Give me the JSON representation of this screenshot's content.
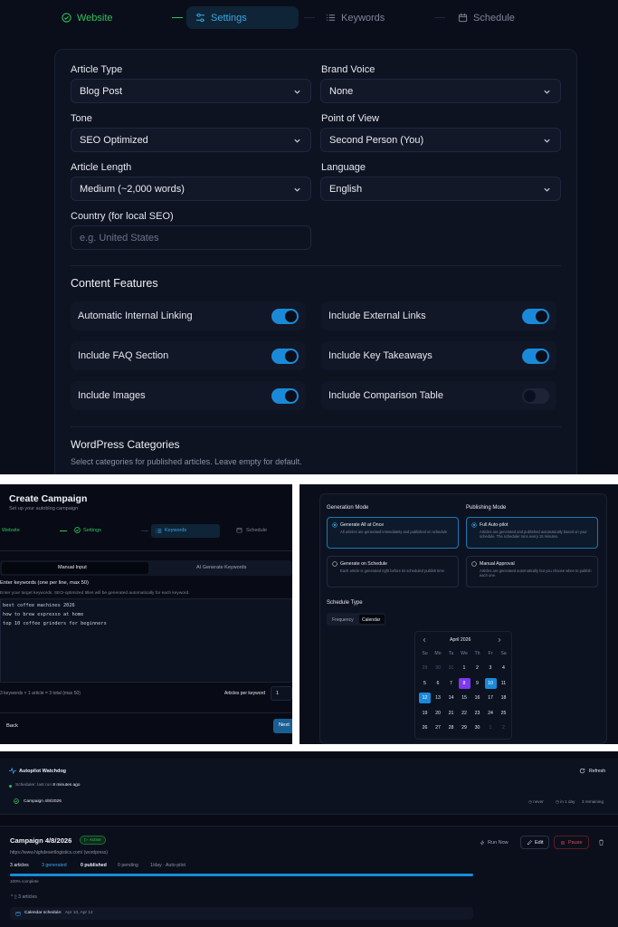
{
  "stepper": {
    "steps": [
      {
        "label": "Website",
        "state": "done"
      },
      {
        "label": "Settings",
        "state": "active"
      },
      {
        "label": "Keywords",
        "state": "pending"
      },
      {
        "label": "Schedule",
        "state": "pending"
      }
    ]
  },
  "settings": {
    "fields": [
      {
        "label": "Article Type",
        "value": "Blog Post"
      },
      {
        "label": "Brand Voice",
        "value": "None"
      },
      {
        "label": "Tone",
        "value": "SEO Optimized"
      },
      {
        "label": "Point of View",
        "value": "Second Person (You)"
      },
      {
        "label": "Article Length",
        "value": "Medium (~2,000 words)"
      },
      {
        "label": "Language",
        "value": "English"
      }
    ],
    "country": {
      "label": "Country (for local SEO)",
      "placeholder": "e.g. United States"
    },
    "features_title": "Content Features",
    "features": [
      {
        "label": "Automatic Internal Linking",
        "on": true
      },
      {
        "label": "Include External Links",
        "on": true
      },
      {
        "label": "Include FAQ Section",
        "on": true
      },
      {
        "label": "Include Key Takeaways",
        "on": true
      },
      {
        "label": "Include Images",
        "on": true
      },
      {
        "label": "Include Comparison Table",
        "on": false
      }
    ],
    "wp_title": "WordPress Categories",
    "wp_desc": "Select categories for published articles. Leave empty for default."
  },
  "create": {
    "title": "Create Campaign",
    "subtitle": "Set up your autoblog campaign",
    "steps": [
      "Website",
      "Settings",
      "Keywords",
      "Schedule"
    ],
    "tabs": [
      "Manual Input",
      "AI Generate Keywords"
    ],
    "kw_label": "Enter keywords (one per line, max 50)",
    "kw_help": "Enter your target keywords. SEO-optimized titles will be generated automatically for each keyword.",
    "keywords": [
      "best coffee machines 2026",
      "how to brew espresso at home",
      "top 10 coffee grinders for beginners"
    ],
    "count_text": "3 keywords × 1 article = 3 total (max 50)",
    "apk_label": "Articles per keyword",
    "apk_value": "1",
    "back": "Back",
    "next": "Next"
  },
  "schedule": {
    "gen_title": "Generation Mode",
    "gen_options": [
      {
        "title": "Generate All at Once",
        "desc": "All articles are generated immediately and published on schedule",
        "active": true
      },
      {
        "title": "Generate on Schedule",
        "desc": "Each article is generated right before its scheduled publish time",
        "active": false
      }
    ],
    "pub_title": "Publishing Mode",
    "pub_options": [
      {
        "title": "Full Auto-pilot",
        "desc": "Articles are generated and published automatically based on your schedule. The scheduler runs every 15 minutes.",
        "active": true
      },
      {
        "title": "Manual Approval",
        "desc": "Articles are generated automatically but you choose when to publish each one.",
        "active": false
      }
    ],
    "type_title": "Schedule Type",
    "type_tabs": [
      "Frequency",
      "Calendar"
    ],
    "calendar": {
      "month": "April 2026",
      "weekdays": [
        "Su",
        "Mo",
        "Tu",
        "We",
        "Th",
        "Fr",
        "Sa"
      ],
      "weeks": [
        [
          "29",
          "30",
          "31",
          "1",
          "2",
          "3",
          "4"
        ],
        [
          "5",
          "6",
          "7",
          "8",
          "9",
          "10",
          "11"
        ],
        [
          "12",
          "13",
          "14",
          "15",
          "16",
          "17",
          "18"
        ],
        [
          "19",
          "20",
          "21",
          "22",
          "23",
          "24",
          "25"
        ],
        [
          "26",
          "27",
          "28",
          "29",
          "30",
          "1",
          "2"
        ]
      ],
      "muted": [
        "29",
        "30",
        "31"
      ],
      "today": "8",
      "selected": [
        "10",
        "12"
      ]
    }
  },
  "watchdog": {
    "title": "Autopilot Watchdog",
    "refresh": "Refresh",
    "scheduler_prefix": "Scheduler: last run",
    "scheduler_ago": "8 minutes ago",
    "campaign": "Campaign 4/8/2026",
    "never": "never",
    "in": "in 1 day",
    "remaining": "3 remaining"
  },
  "campaign": {
    "title": "Campaign 4/8/2026",
    "badge": "Active",
    "url": "https://www.highdesertlogistics.com/ (wordpress)",
    "stats": [
      "3 articles",
      "3 generated",
      "0 published",
      "0 pending",
      "1/day · Auto-pilot"
    ],
    "progress": 100,
    "progress_text": "100% complete",
    "articles": "3 articles",
    "calendar_label": "Calendar schedule:",
    "calendar_dates": "Apr 10, Apr 12",
    "run_now": "Run Now",
    "edit": "Edit",
    "pause": "Pause"
  },
  "colors": {
    "accent": "#1a8ad8",
    "success": "#2fc25b",
    "danger": "#e5484d",
    "purple": "#7c3aed"
  }
}
